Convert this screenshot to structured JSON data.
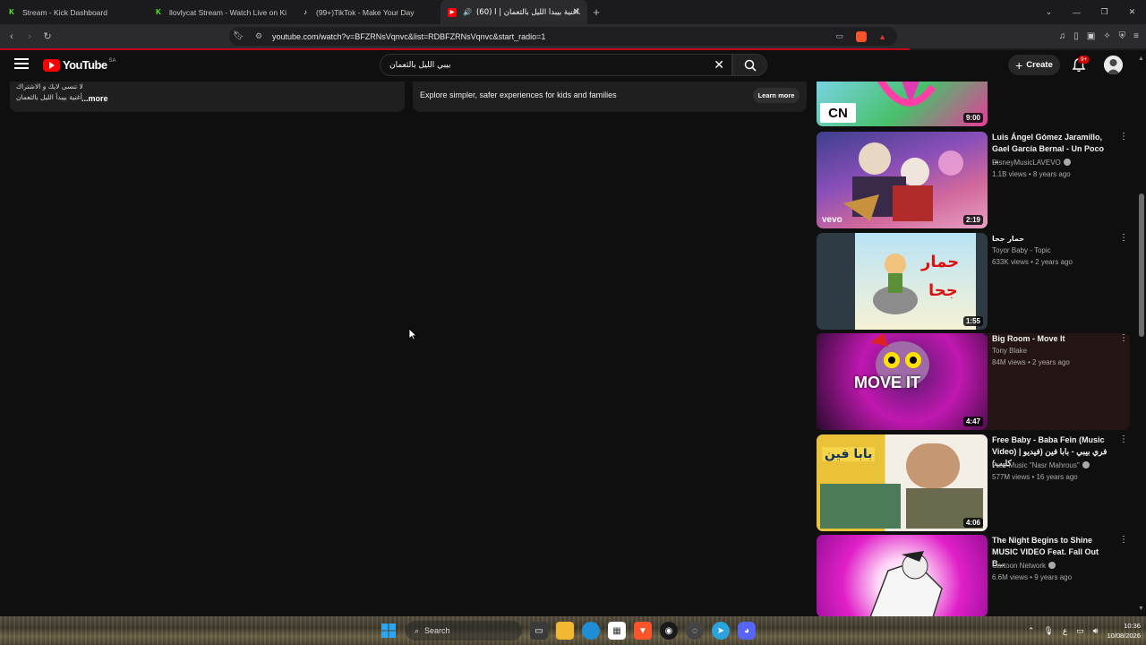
{
  "browser": {
    "tabs": [
      {
        "title": "Stream - Kick Dashboard",
        "favicon": "K",
        "color": "#53fc18"
      },
      {
        "title": "llovlycat Stream - Watch Live on Kick",
        "favicon": "K",
        "color": "#53fc18"
      },
      {
        "title": "(99+)TikTok - Make Your Day",
        "favicon": "♪",
        "color": "#000000"
      },
      {
        "title": "(60) أغنية بيبدأ الليل بالثعمان | أ...",
        "favicon": "▶",
        "color": "#ff0000",
        "active": true
      }
    ],
    "url": "youtube.com/watch?v=BFZRNsVqnvc&list=RDBFZRNsVqnvc&start_radio=1"
  },
  "youtube": {
    "logo_text": "YouTube",
    "country_code": "SA",
    "search_value": "بيبي الليل بالثعمان",
    "create_label": "Create",
    "notif_badge": "9+"
  },
  "description": {
    "line1": "لا تنسى لايك و الاشتراك",
    "line2": "أغنية بيبدأ الليل بالثعمان",
    "more_label": "...more"
  },
  "kids_banner": {
    "text": "Explore simpler, safer experiences for kids and families",
    "button": "Learn more"
  },
  "sidebar_videos": [
    {
      "title": "",
      "channel": "",
      "meta": "",
      "duration": "9:00",
      "verified": false
    },
    {
      "title": "Luis Ángel Gómez Jaramillo, Gael García Bernal - Un Poco ...",
      "channel": "DisneyMusicLAVEVO",
      "meta": "1.1B views • 8 years ago",
      "duration": "2:19",
      "verified": true
    },
    {
      "title": "حمار جحا",
      "channel": "Toyor Baby - Topic",
      "meta": "633K views • 2 years ago",
      "duration": "1:55",
      "verified": false
    },
    {
      "title": "Big Room - Move It",
      "channel": "Tony Blake",
      "meta": "84M views • 2 years ago",
      "duration": "4:47",
      "verified": false
    },
    {
      "title": "Free Baby - Baba Fein (Music Video) | فري بيبي - بابا فين (فيديو كليب)",
      "channel": "Free Music \"Nasr Mahrous\"",
      "meta": "577M views • 16 years ago",
      "duration": "4:06",
      "verified": true
    },
    {
      "title": "The Night Begins to Shine MUSIC VIDEO Feat. Fall Out B...",
      "channel": "Cartoon Network",
      "meta": "6.6M views • 9 years ago",
      "duration": "",
      "verified": true
    }
  ],
  "thumb_text": {
    "move_it": "MOVE IT",
    "baba_fein": "بابا فين",
    "humar": "حمار",
    "juha": "جحا",
    "cn": "CN",
    "vevo": "vevo"
  },
  "taskbar": {
    "search_label": "Search",
    "time": "10:36",
    "date": "10/08/2026"
  }
}
